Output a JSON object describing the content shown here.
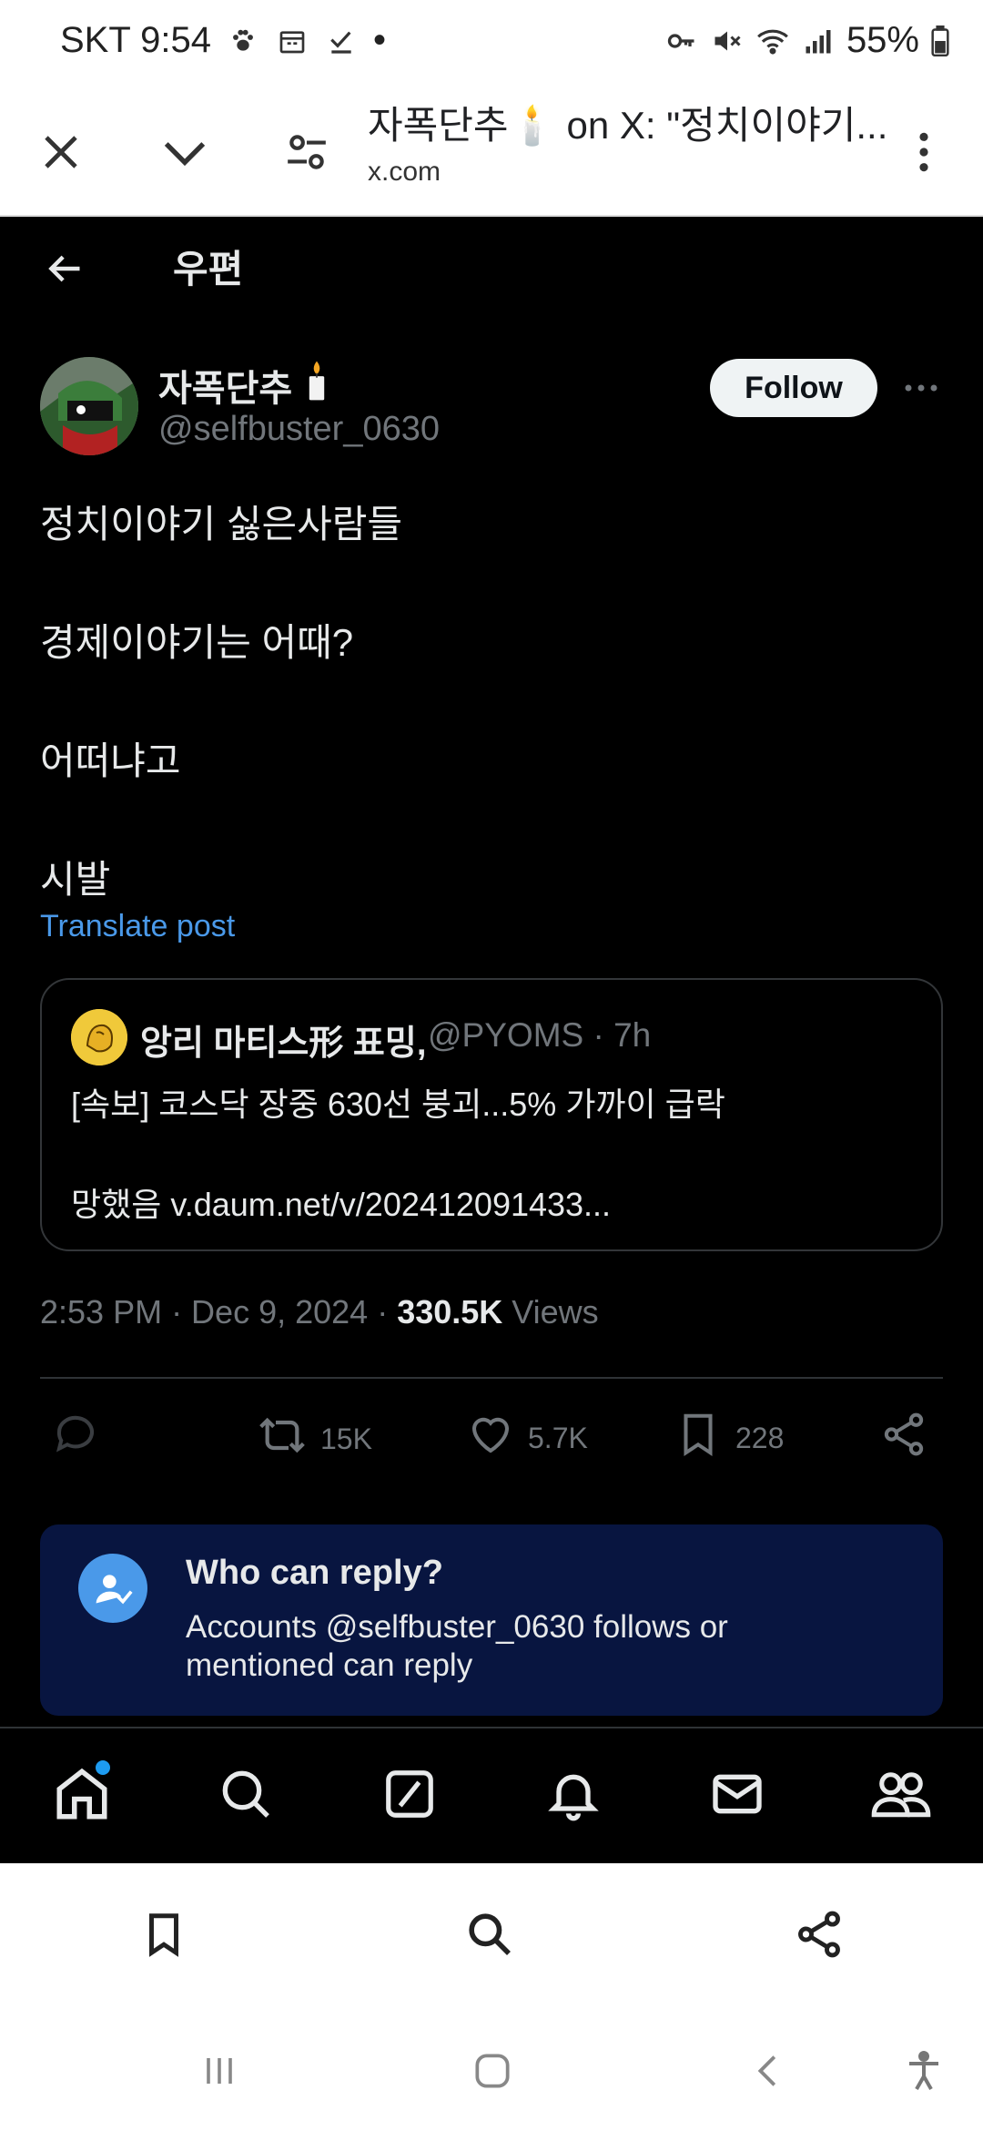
{
  "status_bar": {
    "carrier_time": "SKT 9:54",
    "battery": "55%",
    "dot": "•"
  },
  "browser": {
    "title": "자폭단추🕯️ on X: \"정치이야기...",
    "url": "x.com"
  },
  "header": {
    "title": "우편"
  },
  "author": {
    "name": "자폭단추",
    "handle": "@selfbuster_0630",
    "follow_label": "Follow"
  },
  "post": {
    "lines": [
      "정치이야기 싫은사람들",
      "경제이야기는 어때?",
      "어떠냐고",
      "시발"
    ],
    "translate": "Translate post"
  },
  "quote": {
    "name": "앙리 마티스形 표밍,",
    "meta": "@PYOMS · 7h",
    "line1": "[속보] 코스닥 장중 630선 붕괴...5% 가까이 급락",
    "line2": "망했음 v.daum.net/v/202412091433..."
  },
  "meta": {
    "time_date": "2:53 PM · Dec 9, 2024 · ",
    "views_count": "330.5K",
    "views_label": " Views"
  },
  "actions": {
    "retweets": "15K",
    "likes": "5.7K",
    "bookmarks": "228"
  },
  "who_can_reply": {
    "title": "Who can reply?",
    "desc": "Accounts @selfbuster_0630 follows or mentioned can reply"
  },
  "colors": {
    "accent": "#1d9bf0",
    "link": "#4a99e9",
    "reply_box": "#081540"
  }
}
